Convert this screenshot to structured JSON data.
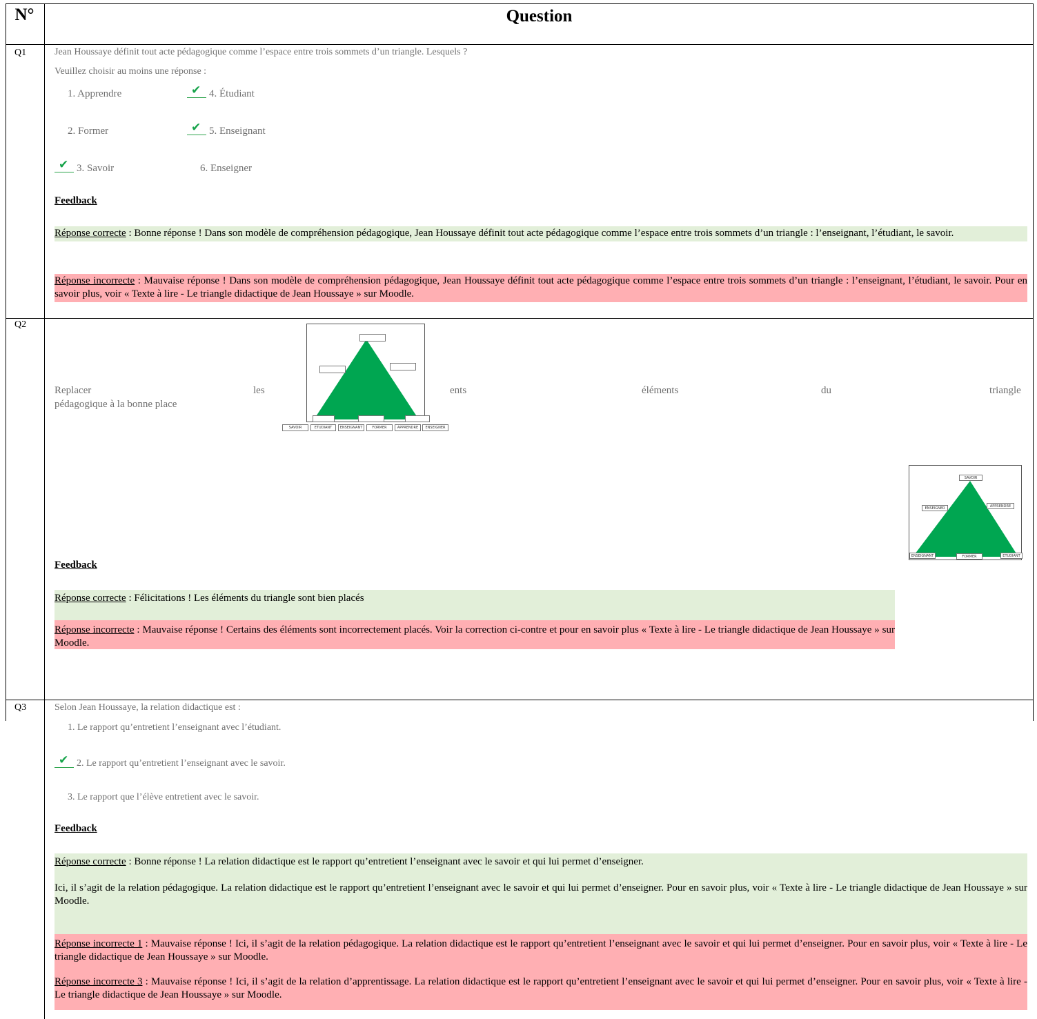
{
  "header": {
    "no": "N°",
    "question": "Question"
  },
  "colors": {
    "correct_bg": "#e2efd9",
    "incorrect_bg": "#ffafb3",
    "check": "#16a34a"
  },
  "q1": {
    "no": "Q1",
    "text": "Jean Houssaye définit tout acte pédagogique comme l’espace entre trois sommets d’un triangle. Lesquels ?",
    "instruction": "Veuillez choisir au moins une réponse :",
    "options": [
      "1. Apprendre",
      "2. Former",
      "3. Savoir",
      "4. Étudiant",
      "5. Enseignant",
      "6. Enseigner"
    ],
    "correct": [
      3,
      4,
      5
    ],
    "feedback_title": "Feedback",
    "correct_label": "Réponse correcte",
    "correct_text": " : Bonne réponse ! Dans son modèle de compréhension pédagogique, Jean Houssaye définit tout acte pédagogique comme l’espace entre trois sommets d’un triangle : l’enseignant, l’étudiant, le savoir.",
    "incorrect_label": "Réponse incorrecte",
    "incorrect_text": " :  Mauvaise réponse !  Dans son modèle de compréhension pédagogique, Jean Houssaye définit tout acte pédagogique comme l’espace entre trois sommets d’un triangle : l’enseignant, l’étudiant, le savoir. Pour en savoir plus, voir « Texte à lire - Le triangle didactique de Jean Houssaye » sur Moodle."
  },
  "q2": {
    "no": "Q2",
    "instruction_words": [
      "Replacer",
      "les",
      "ents",
      "éléments",
      "du",
      "triangle"
    ],
    "instruction_line2": "pédagogique à la bonne place",
    "image_labels": [
      "SAVOIR",
      "ETUDIANT",
      "ENSEIGNANT",
      "FORMER",
      "APPRENDRE",
      "ENSEIGNER"
    ],
    "solution_labels": {
      "top": "SAVOIR",
      "left": "ENSEIGNER",
      "right": "APPRENDRE",
      "bottom_left": "ENSEIGNANT",
      "bottom_mid": "FORMER",
      "bottom_right": "ETUDIANT"
    },
    "feedback_title": "Feedback",
    "correct_label": "Réponse correcte",
    "correct_text": " : Félicitations ! Les éléments du triangle sont bien placés",
    "incorrect_label": "Réponse incorrecte",
    "incorrect_text": " :  Mauvaise réponse !  Certains des éléments sont incorrectement placés. Voir la correction ci-contre et pour en savoir plus « Texte à lire - Le triangle didactique de Jean Houssaye » sur Moodle."
  },
  "q3": {
    "no": "Q3",
    "text": "Selon Jean Houssaye, la relation didactique est :",
    "options": [
      "1. Le rapport qu’entretient l’enseignant avec l’étudiant.",
      "2. Le rapport qu’entretient l’enseignant avec le savoir.",
      "3. Le rapport que l’élève entretient avec le savoir."
    ],
    "correct": [
      2
    ],
    "feedback_title": "Feedback",
    "correct_label": "Réponse correcte",
    "correct_text": " : Bonne réponse ! La relation didactique est le rapport qu’entretient l’enseignant avec le savoir et qui lui permet d’enseigner.",
    "extra_text": "Ici, il s’agit de la relation pédagogique. La relation didactique est le rapport qu’entretient l’enseignant avec le savoir et qui lui permet d’enseigner. Pour en savoir plus, voir « Texte à lire - Le triangle didactique de Jean Houssaye » sur Moodle.",
    "incorrect1_label": "Réponse incorrecte 1",
    "incorrect1_text": " : Mauvaise réponse ! Ici, il s’agit de la relation pédagogique. La relation didactique est le rapport qu’entretient l’enseignant avec le savoir et qui lui permet d’enseigner. Pour en savoir plus, voir « Texte à lire - Le triangle didactique de Jean Houssaye » sur Moodle.",
    "incorrect3_label": "Réponse incorrecte 3",
    "incorrect3_text": " :  Mauvaise réponse ! Ici, il s’agit de la relation d’apprentissage. La relation didactique est le rapport qu’entretient l’enseignant avec le savoir et qui lui permet d’enseigner. Pour en savoir plus, voir « Texte à lire - Le triangle didactique de Jean Houssaye » sur Moodle."
  }
}
